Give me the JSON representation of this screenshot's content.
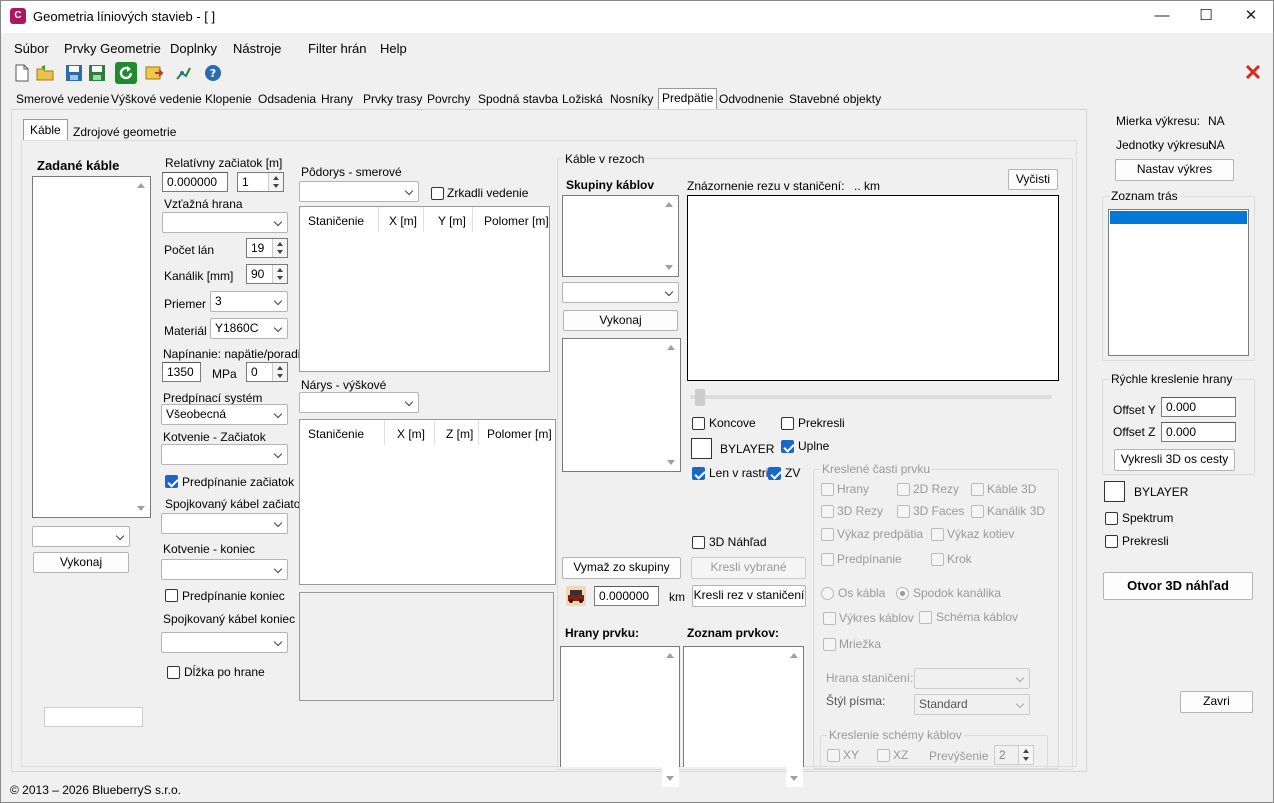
{
  "window": {
    "title": "Geometria líniových stavieb - [ ]",
    "app_icon": "C",
    "min": "—",
    "max": "☐",
    "close": "✕"
  },
  "menu": [
    "Súbor",
    "Prvky Geometrie",
    "Doplnky",
    "Nástroje",
    "Filter hrán",
    "Help"
  ],
  "main_tabs": [
    "Smerové vedenie",
    "Výškové vedenie",
    "Klopenie",
    "Odsadenia",
    "Hrany",
    "Prvky trasy",
    "Povrchy",
    "Spodná stavba",
    "Ložiská",
    "Nosníky",
    "Predpätie",
    "Odvodnenie",
    "Stavebné objekty"
  ],
  "active_tab": "Predpätie",
  "sub_tabs": [
    "Káble",
    "Zdrojové geometrie"
  ],
  "cables": {
    "header": "Zadané káble",
    "execute": "Vykonaj"
  },
  "params": {
    "rel_start_label": "Relatívny začiatok [m]",
    "rel_start_value": "0.000000",
    "rel_start_spin": "1",
    "ref_edge_label": "Vzťažná hrana",
    "strands_label": "Počet lán",
    "strands_value": "19",
    "duct_label": "Kanálik [mm]",
    "duct_value": "90",
    "diameter_label": "Priemer",
    "diameter_value": "3",
    "material_label": "Materiál",
    "material_value": "Y1860C",
    "tension_label": "Napínanie: napätie/poradie",
    "tension_value": "1350",
    "tension_unit": "MPa",
    "tension_order": "0",
    "system_label": "Predpínací systém",
    "system_value": "Všeobecná",
    "anchor_start_label": "Kotvenie - Začiatok",
    "prestress_start": "Predpínanie začiatok",
    "coupled_start": "Spojkovaný kábel začiatok",
    "anchor_end_label": "Kotvenie - koniec",
    "prestress_end": "Predpínanie koniec",
    "coupled_end": "Spojkovaný kábel koniec",
    "length_edge": "Dĺžka po hrane"
  },
  "plan": {
    "label": "Pôdorys - smerové",
    "mirror": "Zrkadli  vedenie",
    "cols": [
      "Staničenie",
      "X [m]",
      "Y [m]",
      "Polomer [m]"
    ]
  },
  "elev": {
    "label": "Nárys - výškové",
    "cols": [
      "Staničenie",
      "X [m]",
      "Z [m]",
      "Polomer [m]"
    ]
  },
  "sections": {
    "title": "Káble v rezoch",
    "groups": "Skupiny káblov",
    "execute": "Vykonaj",
    "preview_label": "Znázornenie rezu v staničení:",
    "preview_km": ".. km",
    "clear": "Vyčisti",
    "end": "Koncove",
    "redraw": "Prekresli",
    "bylayer": "BYLAYER",
    "full": "Uplne",
    "grid_only": "Len v rastri",
    "zv": "ZV",
    "preview3d": "3D Náhľad",
    "remove": "Vymaž zo skupiny",
    "draw_selected": "Kresli vybrané",
    "station": "0.000000",
    "km": "km",
    "draw_section": "Kresli rez v staničení",
    "edges": "Hrany prvku:",
    "elements": "Zoznam prvkov:"
  },
  "drawn": {
    "title": "Kreslené časti prvku",
    "items": [
      "Hrany",
      "2D Rezy",
      "Káble 3D",
      "3D Rezy",
      "3D Faces",
      "Kanálik 3D",
      "Výkaz predpätia",
      "Výkaz kotiev",
      "Predpínanie",
      "Krok"
    ],
    "axis": "Os kábla",
    "duct_bottom": "Spodok kanálika",
    "cable_drawing": "Výkres káblov",
    "cable_schema": "Schéma káblov",
    "grid": "Mriežka",
    "station_edge": "Hrana staničení:",
    "font_style": "Štýl písma:",
    "font_value": "Standard",
    "schema_title": "Kreslenie schémy káblov",
    "xy": "XY",
    "xz": "XZ",
    "overhang": "Prevýšenie",
    "overhang_value": "2"
  },
  "right": {
    "scale_label": "Mierka výkresu:",
    "scale_value": "NA",
    "units_label": "Jednotky výkresu:",
    "units_value": "NA",
    "set_drawing": "Nastav výkres",
    "routes": "Zoznam trás",
    "quick": "Rýchle kreslenie hrany",
    "offset_y_label": "Offset Y",
    "offset_y": "0.000",
    "offset_z_label": "Offset Z",
    "offset_z": "0.000",
    "draw3d": "Vykresli 3D os cesty",
    "bylayer": "BYLAYER",
    "spectrum": "Spektrum",
    "redraw": "Prekresli",
    "open3d": "Otvor 3D náhľad",
    "close": "Zavri"
  },
  "status": "© 2013 – 2026 BlueberryS s.r.o.",
  "colors": {
    "accent": "#1a66c9",
    "selection": "#0078d7",
    "close_red": "#d9261c",
    "app_icon": "#b0155f"
  }
}
